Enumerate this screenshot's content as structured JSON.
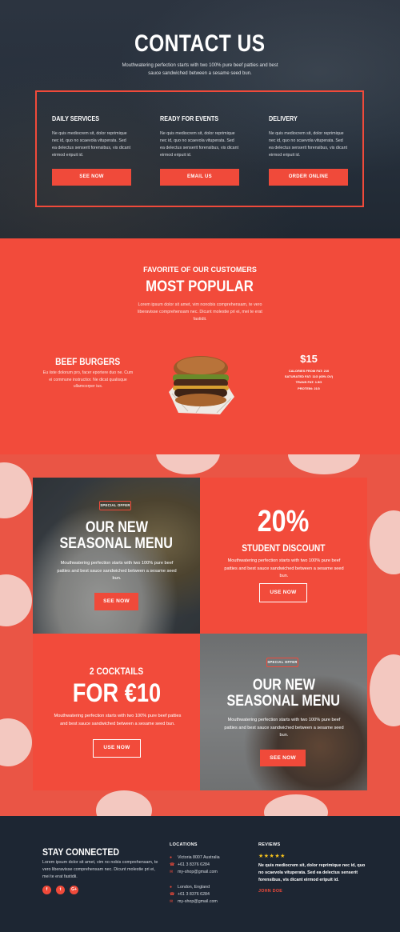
{
  "hero": {
    "title": "CONTACT US",
    "subtitle": "Mouthwatering perfection starts with two 100% pure beef patties and best sauce sandwiched between a sesame seed bun.",
    "services": [
      {
        "title": "DAILY SERVICES",
        "text": "Ne quis mediocrem sit, dolor reprimique nec id, quo no scaevola vituperata. Sed ea delectus senserit forensibus, vis dicant eirmod eripuit id.",
        "button": "SEE NOW"
      },
      {
        "title": "READY FOR EVENTS",
        "text": "Ne quis mediocrem sit, dolor reprimique nec id, quo no scaevola vituperata. Sed ea delectus senserit forensibus, vis dicant eirmod eripuit id.",
        "button": "EMAIL US"
      },
      {
        "title": "DELIVERY",
        "text": "Ne quis mediocrem sit, dolor reprimique nec id, quo no scaevola vituperata. Sed ea delectus senserit forensibus, vis dicant eirmod eripuit id.",
        "button": "ORDER ONLINE"
      }
    ]
  },
  "popular": {
    "kicker": "FAVORITE OF OUR CUSTOMERS",
    "title": "MOST POPULAR",
    "description": "Lorem ipsum dolor sit amet, vim nonobis comprehensam, te vero liberavisse comprehensam nec. Dicunt molestie pri ei, mei te erat fastidii.",
    "item": {
      "name": "BEEF BURGERS",
      "description": "Eu iiste dolorum pro, facer eportere duo ne. Cum ei commune instructior. Ne dicat qualisque ullamcorper ius.",
      "price": "$15",
      "nutrition": [
        "CALORIES FROM FAT: 210",
        "SATURATED FAT: 11G (65% DV)",
        "TRANS FAT: 1.5G",
        "PROTEIN: 21G"
      ]
    }
  },
  "offers": {
    "tile1": {
      "badge": "SPECIAL OFFER",
      "title_line1": "OUR NEW",
      "title_line2": "SEASONAL MENU",
      "description": "Mouthwatering perfection starts with two 100% pure beef patties and best sauce sandwiched between a sesame seed bun.",
      "button": "SEE NOW"
    },
    "tile2": {
      "title": "20%",
      "subtitle": "STUDENT DISCOUNT",
      "description": "Mouthwatering perfection starts with two 100% pure beef patties and best sauce sandwiched between a sesame seed bun.",
      "button": "USE NOW"
    },
    "tile3": {
      "kicker": "2 COCKTAILS",
      "title": "FOR €10",
      "description": "Mouthwatering perfection starts with two 100% pure beef patties and best sauce sandwiched between a sesame seed bun.",
      "button": "USE NOW"
    },
    "tile4": {
      "badge": "SPECIAL OFFER",
      "title_line1": "OUR NEW",
      "title_line2": "SEASONAL MENU",
      "description": "Mouthwatering perfection starts with two 100% pure beef patties and best sauce sandwiched between a sesame seed bun.",
      "button": "SEE NOW"
    }
  },
  "footer": {
    "stay": {
      "title": "STAY CONNECTED",
      "text": "Lorem ipsum dolor sit amet, vim no nobis comprehensam, te vero liberavisse comprehensam nec. Dicunt molestie pri ei, mei te erat fastidii.",
      "social": [
        {
          "icon": "facebook-icon",
          "glyph": "f"
        },
        {
          "icon": "twitter-icon",
          "glyph": "t"
        },
        {
          "icon": "google-plus-icon",
          "glyph": "G+"
        }
      ]
    },
    "locations": {
      "title": "LOCATIONS",
      "groups": [
        {
          "address": "Victoria 8007 Australia",
          "phone": "+61 3 8376 6284",
          "email": "my-shop@gmail.com"
        },
        {
          "address": "London, England",
          "phone": "+61 3 8376 6284",
          "email": "my-shop@gmail.com"
        }
      ]
    },
    "reviews": {
      "title": "REVIEWS",
      "stars": "★★★★★",
      "text": "Ne quis mediocrem sit, dolor reprimique nec id, quo no scaevola vituperata. Sed ea delectus senserit forensibus, vis dicant eirmod eripuit id.",
      "author": "JOHN DOE"
    }
  },
  "colors": {
    "accent": "#f04a3a",
    "dark": "#1d2633",
    "star": "#f6c21c"
  }
}
